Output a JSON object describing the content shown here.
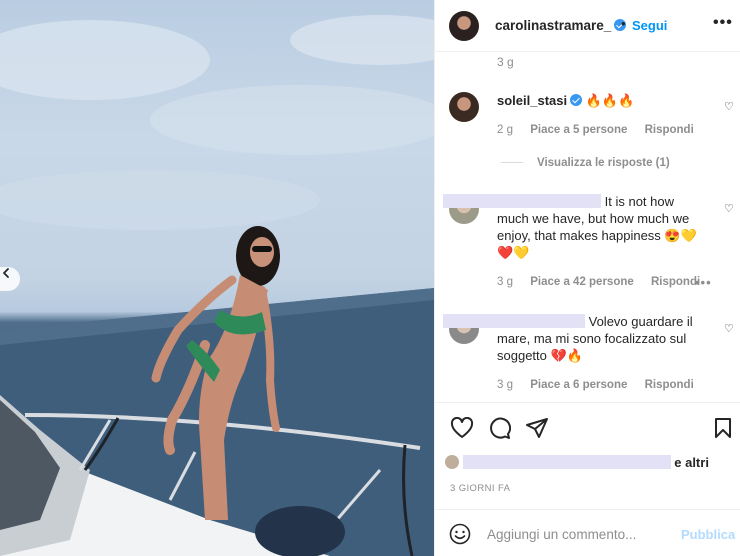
{
  "post": {
    "author": "carolinastramare_",
    "dot": "•",
    "follow_label": "Segui",
    "more_label": "•••"
  },
  "comments": {
    "top_time": "3 g",
    "items": [
      {
        "user": "soleil_stasi",
        "text": "🔥🔥🔥",
        "time": "2 g",
        "likes": "Piace a 5 persone",
        "reply_label": "Rispondi",
        "view_replies": "Visualizza le risposte (1)"
      },
      {
        "user": "",
        "text_line1": "It is not how",
        "text_rest": "much we have, but how much we enjoy, that makes happiness 😍💛 ❤️💛",
        "time": "3 g",
        "likes": "Piace a 42 persone",
        "reply_label": "Rispondi",
        "more_label": "•••"
      },
      {
        "user": "",
        "text_line1": "Volevo guardare il",
        "text_rest": "mare, ma mi sono focalizzato sul soggetto 💔🔥",
        "time": "3 g",
        "likes": "Piace a 6 persone",
        "reply_label": "Rispondi"
      }
    ]
  },
  "likes_suffix": "e altri",
  "date": "3 GIORNI FA",
  "add_comment": {
    "placeholder": "Aggiungi un commento...",
    "publish_label": "Pubblica"
  },
  "colors": {
    "accent": "#0095f6",
    "muted": "#8e8e8e",
    "redaction": "#e3e1f6"
  },
  "icons": [
    "chevron-left-icon",
    "verified-badge-icon",
    "heart-icon",
    "comment-icon",
    "share-icon",
    "bookmark-icon",
    "emoji-icon",
    "more-icon"
  ]
}
